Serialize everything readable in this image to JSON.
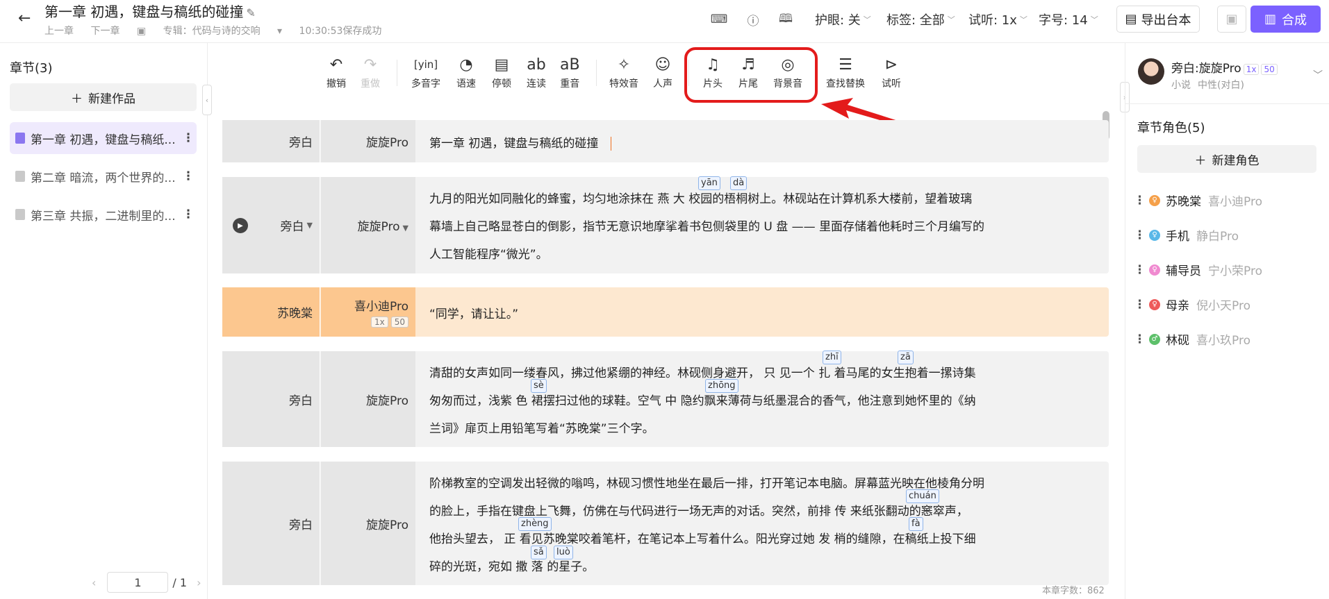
{
  "header": {
    "title": "第一章 初遇，键盘与稿纸的碰撞",
    "prev": "上一章",
    "next": "下一章",
    "album": "专辑：代码与诗的交响",
    "saved": "10:30:53保存成功",
    "eye": "护眼: 关",
    "tag": "标签: 全部",
    "listen": "试听: 1x",
    "fontsize": "字号: 14",
    "export": "导出台本",
    "synth": "合成"
  },
  "sidebar": {
    "heading": "章节(3)",
    "new_work": "新建作品",
    "chapters": [
      "第一章 初遇，键盘与稿纸...",
      "第二章 暗流，两个世界的...",
      "第三章 共振，二进制里的..."
    ],
    "page": "1",
    "total": "/ 1"
  },
  "toolbar": {
    "undo": "撤销",
    "redo": "重做",
    "poly": "多音字",
    "speed": "语速",
    "pause": "停顿",
    "liaison": "连读",
    "stress": "重音",
    "sfx": "特效音",
    "human": "人声",
    "intro": "片头",
    "outro": "片尾",
    "bgm": "背景音",
    "find": "查找替换",
    "preview": "试听"
  },
  "segments": [
    {
      "role": "旁白",
      "voice": "旋旋Pro",
      "lines": [
        "第一章 初遇，键盘与稿纸的碰撞"
      ]
    },
    {
      "role": "旁白",
      "voice": "旋旋Pro",
      "lines": [
        "九月的阳光如同融化的蜂蜜，均匀地涂抹在 燕 大 校园的梧桐树上。林砚站在计算机系大楼前，望着玻璃",
        "幕墙上自己略显苍白的倒影，指节无意识地摩挲着书包侧袋里的 U 盘 —— 里面存储着他耗时三个月编写的",
        "人工智能程序“微光”。"
      ]
    },
    {
      "role": "苏晚棠",
      "voice": "喜小迪Pro",
      "speed": "1x",
      "level": "50",
      "lines": [
        "“同学，请让让。”"
      ]
    },
    {
      "role": "旁白",
      "voice": "旋旋Pro",
      "lines": [
        "清甜的女声如同一缕春风，拂过他紧绷的神经。林砚侧身避开， 只 见一个 扎 着马尾的女生抱着一摞诗集",
        "匆匆而过，浅紫 色 裙摆扫过他的球鞋。空气  中  隐约飘来薄荷与纸墨混合的香气，他注意到她怀里的《纳",
        "兰词》扉页上用铅笔写着“苏晚棠”三个字。"
      ]
    },
    {
      "role": "旁白",
      "voice": "旋旋Pro",
      "lines": [
        "阶梯教室的空调发出轻微的嗡鸣，林砚习惯性地坐在最后一排，打开笔记本电脑。屏幕蓝光映在他棱角分明",
        "的脸上，手指在键盘上飞舞，仿佛在与代码进行一场无声的对话。突然，前排  传  来纸张翻动的窸窣声，",
        "他抬头望去，  正  看见苏晚棠咬着笔杆，在笔记本上写着什么。阳光穿过她 发 梢的缝隙，在稿纸上投下细",
        "碎的光斑，宛如 撒  落  的星子。"
      ]
    }
  ],
  "pinyin": [
    "yān",
    "dà",
    "zhī",
    "zā",
    "sè",
    "zhōng",
    "chuán",
    "zhèng",
    "fà",
    "sǎ",
    "luò"
  ],
  "wordcount": "本章字数：862",
  "right": {
    "narrator": "旁白:旋旋Pro",
    "speed": "1x",
    "level": "50",
    "desc": "小说",
    "tone": "中性(对白)",
    "heading": "章节角色(5)",
    "new_role": "新建角色",
    "roles": [
      {
        "name": "苏晚棠",
        "voice": "喜小迪Pro",
        "color": "#f5a04a"
      },
      {
        "name": "手机",
        "voice": "静白Pro",
        "color": "#5ab8e8"
      },
      {
        "name": "辅导员",
        "voice": "宁小荣Pro",
        "color": "#f08ad0"
      },
      {
        "name": "母亲",
        "voice": "倪小天Pro",
        "color": "#ee5a5a"
      },
      {
        "name": "林砚",
        "voice": "喜小玖Pro",
        "color": "#5dc06a"
      }
    ]
  }
}
